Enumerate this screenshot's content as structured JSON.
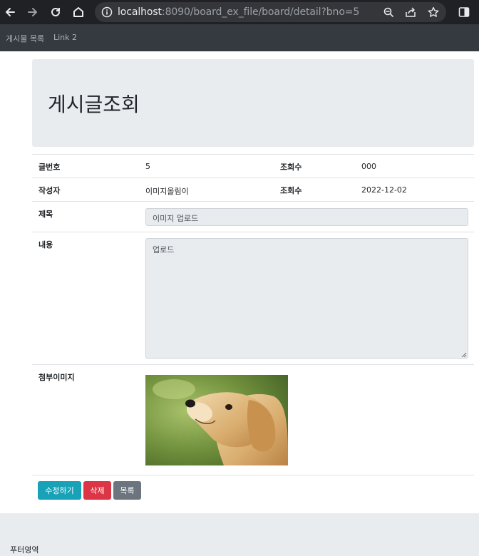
{
  "browser": {
    "url_host": "localhost",
    "url_rest": ":8090/board_ex_file/board/detail?bno=5"
  },
  "navbar": {
    "items": [
      {
        "label": "게시물 목록"
      },
      {
        "label": "Link 2"
      }
    ]
  },
  "page": {
    "title": "게시글조회"
  },
  "detail": {
    "bno_label": "글번호",
    "bno_value": "5",
    "views_label": "조회수",
    "views_value": "000",
    "writer_label": "작성자",
    "writer_value": "이미지올림이",
    "date_label": "조회수",
    "date_value": "2022-12-02",
    "title_label": "제목",
    "title_value": "이미지 업로드",
    "content_label": "내용",
    "content_value": "업로드",
    "attach_label": "첨부이미지"
  },
  "buttons": {
    "edit": "수정하기",
    "delete": "삭제",
    "list": "목록"
  },
  "colors": {
    "edit": "#17a2b8",
    "delete": "#dc3545",
    "list": "#6c757d"
  },
  "footer": {
    "text": "푸터영역"
  }
}
